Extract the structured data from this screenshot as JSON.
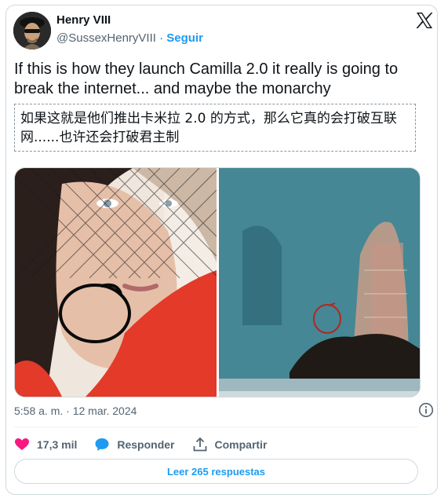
{
  "author": {
    "name": "Henry VIII",
    "handle": "@SussexHenryVIII",
    "separator": "·",
    "follow_label": "Seguir"
  },
  "tweet": {
    "text": "If this is how they launch Camilla 2.0 it really is going to break the internet... and maybe the monarchy",
    "translation": "如果这就是他们推出卡米拉 2.0 的方式，那么它真的会打破互联网......也许还会打破君主制",
    "timestamp": "5:58 a. m. · 12 mar. 2024"
  },
  "actions": {
    "likes": "17,3 mil",
    "reply_label": "Responder",
    "share_label": "Compartir"
  },
  "read_replies_label": "Leer 265 respuestas",
  "icons": {
    "x": "x-logo-icon",
    "info": "info-icon",
    "like": "heart-icon",
    "reply": "speech-bubble-icon",
    "share": "share-icon"
  },
  "colors": {
    "accent": "#1d9bf0",
    "like": "#f91880",
    "text": "#0f1419",
    "secondary": "#536471",
    "border": "#cfd9de"
  }
}
